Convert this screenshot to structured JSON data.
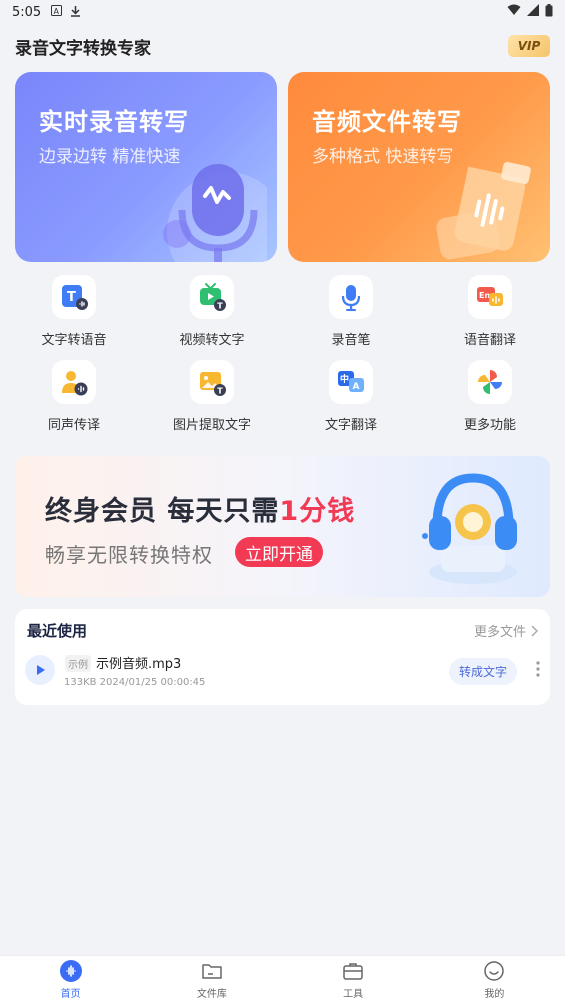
{
  "status_bar": {
    "time": "5:05",
    "icons": [
      "a-icon",
      "download-icon",
      "wifi-icon",
      "signal-icon",
      "battery-icon"
    ]
  },
  "header": {
    "title": "录音文字转换专家",
    "vip_label": "VIP"
  },
  "cards": [
    {
      "title": "实时录音转写",
      "subtitle": "边录边转 精准快速",
      "icon": "microphone-icon"
    },
    {
      "title": "音频文件转写",
      "subtitle": "多种格式 快速转写",
      "icon": "audio-file-icon"
    }
  ],
  "tools": [
    {
      "label": "文字转语音",
      "icon": "text-to-speech-icon"
    },
    {
      "label": "视频转文字",
      "icon": "video-to-text-icon"
    },
    {
      "label": "录音笔",
      "icon": "recorder-pen-icon"
    },
    {
      "label": "语音翻译",
      "icon": "voice-translate-icon"
    },
    {
      "label": "同声传译",
      "icon": "simultaneous-interpret-icon"
    },
    {
      "label": "图片提取文字",
      "icon": "image-text-icon"
    },
    {
      "label": "文字翻译",
      "icon": "text-translate-icon"
    },
    {
      "label": "更多功能",
      "icon": "more-functions-icon"
    }
  ],
  "banner": {
    "title_part1": "终身会员  每天只需",
    "title_highlight": "1分钱",
    "subtitle": "畅享无限转换特权",
    "button_label": "立即开通"
  },
  "recent": {
    "title": "最近使用",
    "more_label": "更多文件",
    "items": [
      {
        "tag": "示例",
        "name": "示例音频.mp3",
        "meta": "133KB 2024/01/25 00:00:45",
        "action_label": "转成文字"
      }
    ]
  },
  "bottom_nav": [
    {
      "label": "首页",
      "icon": "home-icon",
      "active": true
    },
    {
      "label": "文件库",
      "icon": "folder-icon",
      "active": false
    },
    {
      "label": "工具",
      "icon": "toolbox-icon",
      "active": false
    },
    {
      "label": "我的",
      "icon": "profile-icon",
      "active": false
    }
  ],
  "colors": {
    "accent": "#3b6cf5",
    "realtime_card": "#7a86fa",
    "audio_card": "#ff8a3d",
    "promo_highlight": "#f23a55"
  }
}
